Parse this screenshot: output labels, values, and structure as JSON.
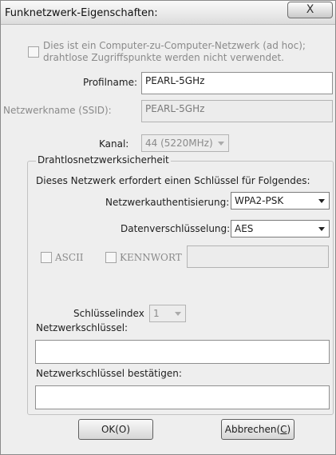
{
  "window": {
    "title": "Funknetzwerk-Eigenschaften:",
    "close_glyph": "X"
  },
  "adhoc": {
    "checked": false,
    "line1": "Dies ist ein Computer-zu-Computer-Netzwerk (ad hoc);",
    "line2": "drahtlose Zugriffspunkte werden nicht verwendet."
  },
  "profile": {
    "label": "Profilname:",
    "value": "PEARL-5GHz"
  },
  "ssid": {
    "label": "Netzwerkname (SSID):",
    "value": "PEARL-5GHz"
  },
  "channel": {
    "label": "Kanal:",
    "value": "44 (5220MHz)"
  },
  "security": {
    "legend": "Drahtlosnetzwerksicherheit",
    "description": "Dieses Netzwerk erfordert einen Schlüssel für Folgendes:",
    "auth_label": "Netzwerkauthentisierung:",
    "auth_value": "WPA2-PSK",
    "encryption_label": "Datenverschlüsselung:",
    "encryption_value": "AES",
    "ascii_label": "ASCII",
    "password_label": "KENNWORT",
    "password_value": "",
    "key_index_label": "Schlüsselindex",
    "key_index_value": "1",
    "key_label": "Netzwerkschlüssel:",
    "key_value": "",
    "confirm_label": "Netzwerkschlüssel bestätigen:",
    "confirm_value": ""
  },
  "buttons": {
    "ok": "OK(O)",
    "cancel_prefix": "Abbrechen(",
    "cancel_mnemonic": "C",
    "cancel_suffix": ")"
  }
}
